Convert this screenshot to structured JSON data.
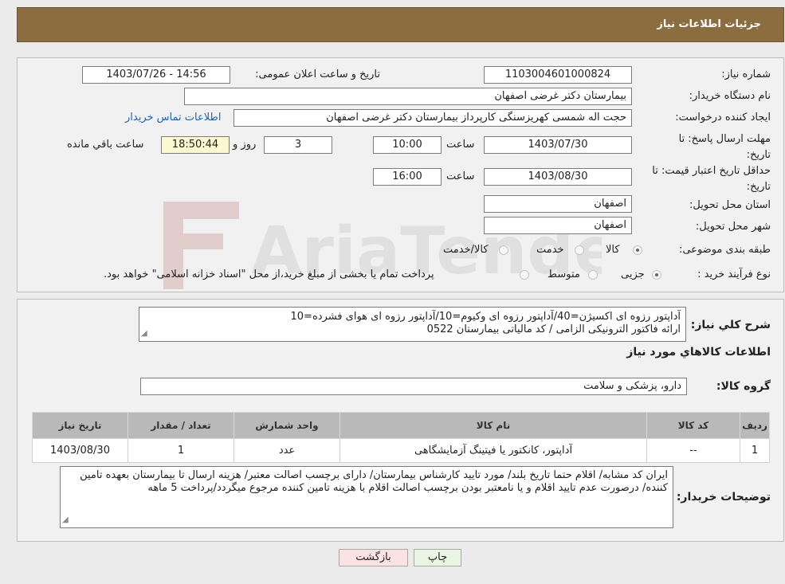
{
  "header": {
    "title": "جزئیات اطلاعات نیاز"
  },
  "form": {
    "need_number_label": "شماره نیاز:",
    "need_number": "1103004601000824",
    "announce_label": "تاریخ و ساعت اعلان عمومی:",
    "announce_value": "1403/07/26 - 14:56",
    "buyer_org_label": "نام دستگاه خریدار:",
    "buyer_org": "بیمارستان دکتر غرضی اصفهان",
    "creator_label": "ایجاد کننده درخواست:",
    "creator": "حجت اله شمسی کهریزسنگی کارپرداز بیمارستان دکتر غرضی اصفهان",
    "contact_link": "اطلاعات تماس خریدار",
    "reply_deadline_label": "مهلت ارسال پاسخ: تا تاریخ:",
    "reply_date": "1403/07/30",
    "time_label": "ساعت",
    "reply_time": "10:00",
    "days": "3",
    "days_label": "روز و",
    "remaining_time": "18:50:44",
    "remaining_label": "ساعت باقي مانده",
    "price_validity_label": "حداقل تاریخ اعتبار قیمت: تا تاریخ:",
    "price_date": "1403/08/30",
    "price_time": "16:00",
    "province_label": "استان محل تحویل:",
    "province": "اصفهان",
    "city_label": "شهر محل تحویل:",
    "city": "اصفهان",
    "category_label": "طبقه بندی موضوعی:",
    "category_options": [
      "کالا",
      "خدمت",
      "کالا/خدمت"
    ],
    "purchase_type_label": "نوع فرآیند خرید :",
    "purchase_options": [
      "جزیی",
      "متوسط"
    ],
    "purchase_note": "پرداخت تمام یا بخشی از مبلغ خرید،از محل \"اسناد خزانه اسلامی\" خواهد بود."
  },
  "summary": {
    "label": "شرح کلي نياز:",
    "line1": "آداپتور رزوه ای اکسیژن=40/آداپتور رزوه ای وکیوم=10/آداپتور رزوه ای هوای فشرده=10",
    "line2": "ارائه فاکتور الترونیکی الزامی / کد مالیاتی بیمارستان 0522",
    "goods_info_title": "اطلاعات کالاهاي مورد نياز",
    "goods_group_label": "گروه کالا:",
    "goods_group": "دارو، پزشکی و سلامت"
  },
  "table": {
    "headers": [
      "رديف",
      "کد کالا",
      "نام کالا",
      "واحد شمارش",
      "تعداد / مقدار",
      "تاریخ نیاز"
    ],
    "rows": [
      {
        "row": "1",
        "code": "--",
        "name": "آداپتور، کانکتور یا فیتینگ آزمایشگاهی",
        "unit": "عدد",
        "qty": "1",
        "date": "1403/08/30"
      }
    ]
  },
  "buyer_notes": {
    "label": "توضیحات خریدار:",
    "text": "ایران کد مشابه/ اقلام حتما تاریخ بلند/ مورد تایید کارشناس بیمارستان/ دارای برچسب اصالت معتبر/ هزینه ارسال تا بیمارستان بعهده تامین کننده/ درصورت عدم تایید اقلام و یا نامعتبر بودن برچسب اصالت اقلام با هزینه تامین کننده مرجوع میگردد/پرداخت 5 ماهه"
  },
  "buttons": {
    "print": "چاپ",
    "back": "بازگشت"
  },
  "watermark": {
    "text": "AriaTender.neT"
  }
}
